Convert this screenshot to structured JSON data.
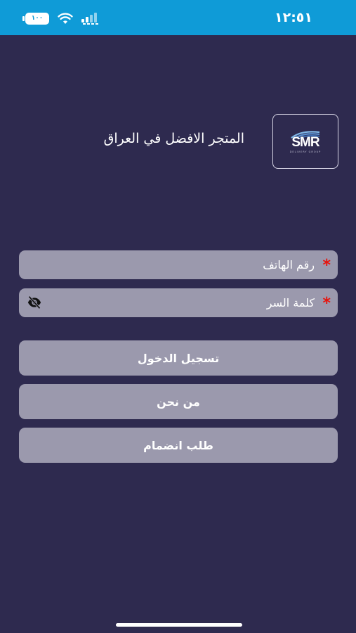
{
  "status_bar": {
    "time": "١٢:٥١",
    "battery_level": "١٠٠",
    "background_color": "#0f9bd7",
    "icons": [
      "battery-icon",
      "wifi-icon",
      "signal-icon"
    ]
  },
  "header": {
    "logo_text": "SMR",
    "logo_subtext": "DELIVERY GROUP",
    "tagline": "المتجر الافضل في العراق"
  },
  "form": {
    "phone": {
      "required_mark": "*",
      "placeholder": "رقم الهاتف",
      "value": ""
    },
    "password": {
      "required_mark": "*",
      "placeholder": "كلمة السر",
      "value": "",
      "toggle_icon": "eye-off-icon"
    }
  },
  "buttons": {
    "login": "تسجيل الدخول",
    "about": "من نحن",
    "join": "طلب انضمام"
  },
  "colors": {
    "background": "#2e2a4f",
    "field": "#9b99ad",
    "required": "#e8130c"
  }
}
